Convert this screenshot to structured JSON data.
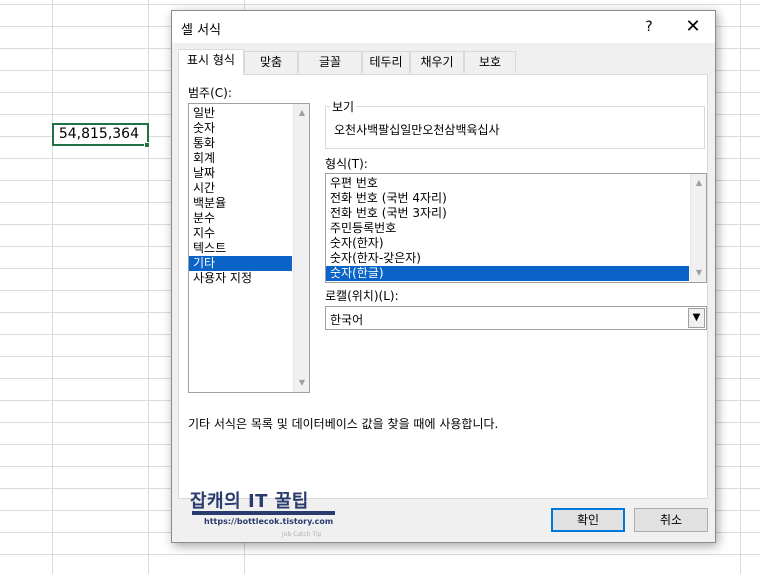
{
  "sheet": {
    "cell_value": "54,815,364"
  },
  "dialog": {
    "title": "셀 서식",
    "help_label": "?",
    "close_label": "✕",
    "tabs": [
      "표시 형식",
      "맞춤",
      "글꼴",
      "테두리",
      "채우기",
      "보호"
    ],
    "active_tab": "표시 형식",
    "category_label": "범주(C):",
    "categories": [
      "일반",
      "숫자",
      "통화",
      "회계",
      "날짜",
      "시간",
      "백분율",
      "분수",
      "지수",
      "텍스트",
      "기타",
      "사용자 지정"
    ],
    "selected_category": "기타",
    "sample_label": "보기",
    "sample_value": "오천사백팔십일만오천삼백육십사",
    "type_label": "형식(T):",
    "types": [
      "우편 번호",
      "전화 번호 (국번 4자리)",
      "전화 번호 (국번 3자리)",
      "주민등록번호",
      "숫자(한자)",
      "숫자(한자-갖은자)",
      "숫자(한글)"
    ],
    "selected_type": "숫자(한글)",
    "locale_label": "로캘(위치)(L):",
    "locale_value": "한국어",
    "description": "기타 서식은 목록 및 데이터베이스 값을 찾을 때에 사용합니다.",
    "ok_label": "확인",
    "cancel_label": "취소"
  },
  "watermark": {
    "title": "잡캐의 IT 꿀팁",
    "url": "https://bottlecok.tistory.com",
    "small": "Job Catch Tip"
  },
  "colors": {
    "accent": "#0078d7",
    "selection": "#0a64c8",
    "cell_border": "#217346",
    "watermark": "#2a3b6e"
  }
}
